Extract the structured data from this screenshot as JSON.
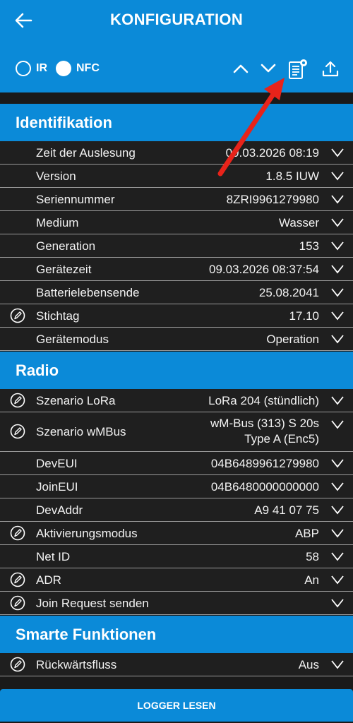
{
  "header": {
    "title": "KONFIGURATION"
  },
  "mode": {
    "ir_label": "IR",
    "nfc_label": "NFC",
    "selected": "NFC"
  },
  "sections": {
    "ident": "Identifikation",
    "radio": "Radio",
    "smart": "Smarte Funktionen"
  },
  "ident_rows": [
    {
      "label": "Zeit der Auslesung",
      "value": "09.03.2026 08:19"
    },
    {
      "label": "Version",
      "value": "1.8.5 IUW"
    },
    {
      "label": "Seriennummer",
      "value": "8ZRI9961279980"
    },
    {
      "label": "Medium",
      "value": "Wasser"
    },
    {
      "label": "Generation",
      "value": "153"
    },
    {
      "label": "Gerätezeit",
      "value": "09.03.2026 08:37:54"
    },
    {
      "label": "Batterielebensende",
      "value": "25.08.2041"
    },
    {
      "label": "Stichtag",
      "value": "17.10"
    },
    {
      "label": "Gerätemodus",
      "value": "Operation"
    }
  ],
  "radio_rows": [
    {
      "label": "Szenario LoRa",
      "value": "LoRa 204 (stündlich)"
    },
    {
      "label": "Szenario wMBus",
      "value": "wM-Bus (313) S 20s",
      "value2": "Type A (Enc5)"
    },
    {
      "label": "DevEUI",
      "value": "04B6489961279980"
    },
    {
      "label": "JoinEUI",
      "value": "04B6480000000000"
    },
    {
      "label": "DevAddr",
      "value": "A9 41 07 75"
    },
    {
      "label": "Aktivierungsmodus",
      "value": "ABP"
    },
    {
      "label": "Net ID",
      "value": "58"
    },
    {
      "label": "ADR",
      "value": "An"
    },
    {
      "label": "Join Request senden",
      "value": ""
    }
  ],
  "smart_rows": [
    {
      "label": "Rückwärtsfluss",
      "value": "Aus"
    }
  ],
  "footer": {
    "button_label": "LOGGER LESEN"
  },
  "colors": {
    "accent": "#0b8ad8",
    "arrow": "#e8231a"
  }
}
